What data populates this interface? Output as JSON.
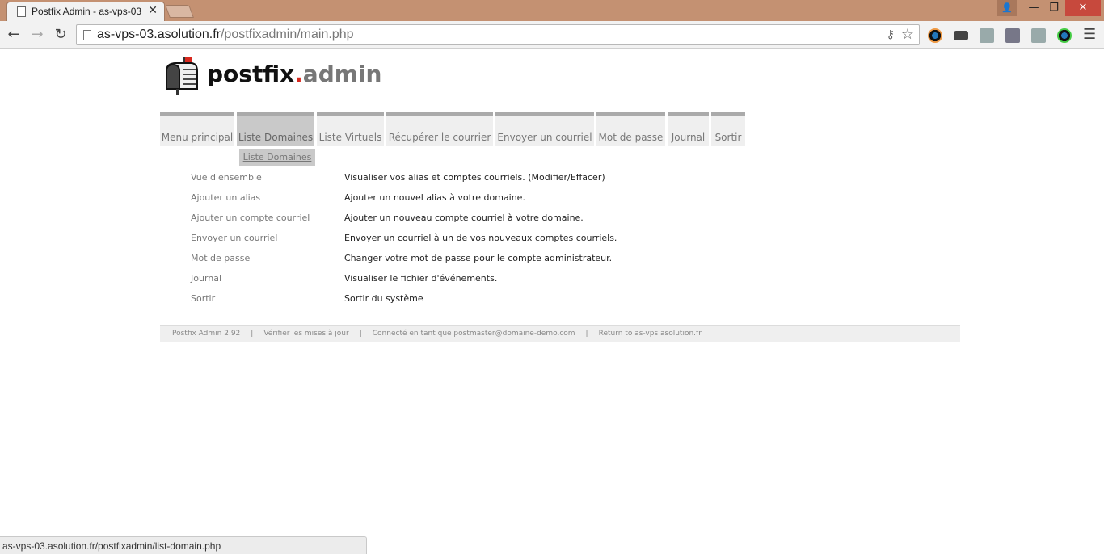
{
  "browser": {
    "tab_title": "Postfix Admin - as-vps-03",
    "url_host": "as-vps-03.asolution.fr",
    "url_path": "/postfixadmin/main.php",
    "status_url": "as-vps-03.asolution.fr/postfixadmin/list-domain.php"
  },
  "logo": {
    "postfix": "postfix",
    "dot": ".",
    "admin": "admin"
  },
  "menu": [
    {
      "label": "Menu principal"
    },
    {
      "label": "Liste Domaines"
    },
    {
      "label": "Liste Virtuels"
    },
    {
      "label": "Récupérer le courrier"
    },
    {
      "label": "Envoyer un courriel"
    },
    {
      "label": "Mot de passe"
    },
    {
      "label": "Journal"
    },
    {
      "label": "Sortir"
    }
  ],
  "submenu": {
    "label": "Liste Domaines"
  },
  "main": [
    {
      "link": "Vue d'ensemble",
      "desc": "Visualiser vos alias et comptes courriels. (Modifier/Effacer)"
    },
    {
      "link": "Ajouter un alias",
      "desc": "Ajouter un nouvel alias à votre domaine."
    },
    {
      "link": "Ajouter un compte courriel",
      "desc": "Ajouter un nouveau compte courriel à votre domaine."
    },
    {
      "link": "Envoyer un courriel",
      "desc": "Envoyer un courriel à un de vos nouveaux comptes courriels."
    },
    {
      "link": "Mot de passe",
      "desc": "Changer votre mot de passe pour le compte administrateur."
    },
    {
      "link": "Journal",
      "desc": "Visualiser le fichier d'événements."
    },
    {
      "link": "Sortir",
      "desc": "Sortir du système"
    }
  ],
  "footer": {
    "version": "Postfix Admin 2.92",
    "check_updates": "Vérifier les mises à jour",
    "connected_as": "Connecté en tant que postmaster@domaine-demo.com",
    "return_to": "Return to as-vps.asolution.fr",
    "separator": "|"
  }
}
